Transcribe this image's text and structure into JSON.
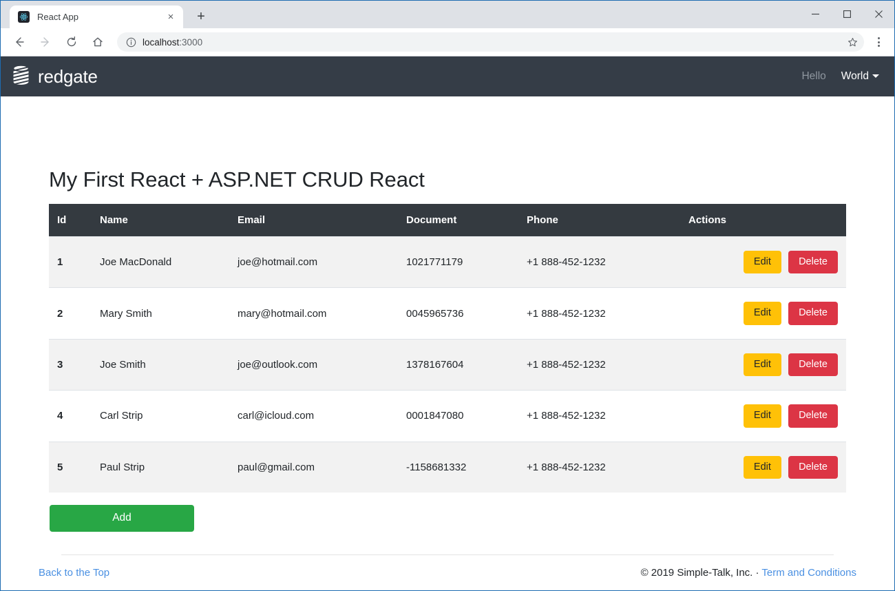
{
  "browser": {
    "tab": {
      "title": "React App",
      "favicon_icon": "react-logo-icon",
      "close_icon": "×"
    },
    "new_tab_icon": "+",
    "window_controls": {
      "minimize_icon": "−",
      "maximize_icon": "□",
      "close_icon": "✕"
    },
    "toolbar": {
      "back_icon": "←",
      "forward_icon": "→",
      "reload_icon": "⟳",
      "home_icon": "⌂",
      "info_icon": "ⓘ",
      "star_icon": "☆",
      "menu_icon": "kebab-menu-icon",
      "url_host": "localhost",
      "url_port": ":3000",
      "url_full": "localhost:3000"
    }
  },
  "navbar": {
    "brand": "redgate",
    "brand_icon": "redgate-database-logo-icon",
    "links": [
      {
        "label": "Hello",
        "active": false
      },
      {
        "label": "World",
        "active": true,
        "has_caret": true
      }
    ]
  },
  "main": {
    "page_title": "My First React + ASP.NET CRUD React",
    "table": {
      "columns": [
        "Id",
        "Name",
        "Email",
        "Document",
        "Phone",
        "Actions"
      ],
      "rows": [
        {
          "id": "1",
          "name": "Joe MacDonald",
          "email": "joe@hotmail.com",
          "document": "1021771179",
          "phone": "+1 888-452-1232",
          "edit_label": "Edit",
          "delete_label": "Delete"
        },
        {
          "id": "2",
          "name": "Mary Smith",
          "email": "mary@hotmail.com",
          "document": "0045965736",
          "phone": "+1 888-452-1232",
          "edit_label": "Edit",
          "delete_label": "Delete"
        },
        {
          "id": "3",
          "name": "Joe Smith",
          "email": "joe@outlook.com",
          "document": "1378167604",
          "phone": "+1 888-452-1232",
          "edit_label": "Edit",
          "delete_label": "Delete"
        },
        {
          "id": "4",
          "name": "Carl Strip",
          "email": "carl@icloud.com",
          "document": "0001847080",
          "phone": "+1 888-452-1232",
          "edit_label": "Edit",
          "delete_label": "Delete"
        },
        {
          "id": "5",
          "name": "Paul Strip",
          "email": "paul@gmail.com",
          "document": "-1158681332",
          "phone": "+1 888-452-1232",
          "edit_label": "Edit",
          "delete_label": "Delete"
        }
      ]
    },
    "add_button_label": "Add"
  },
  "footer": {
    "back_to_top": "Back to the Top",
    "copyright": "© 2019 Simple-Talk, Inc. · ",
    "terms_link": "Term and Conditions"
  },
  "colors": {
    "navbar_bg": "#353d47",
    "table_header_bg": "#343a40",
    "edit_button": "#ffc107",
    "delete_button": "#dc3545",
    "add_button": "#28a745",
    "link_blue": "#4a90e2"
  }
}
